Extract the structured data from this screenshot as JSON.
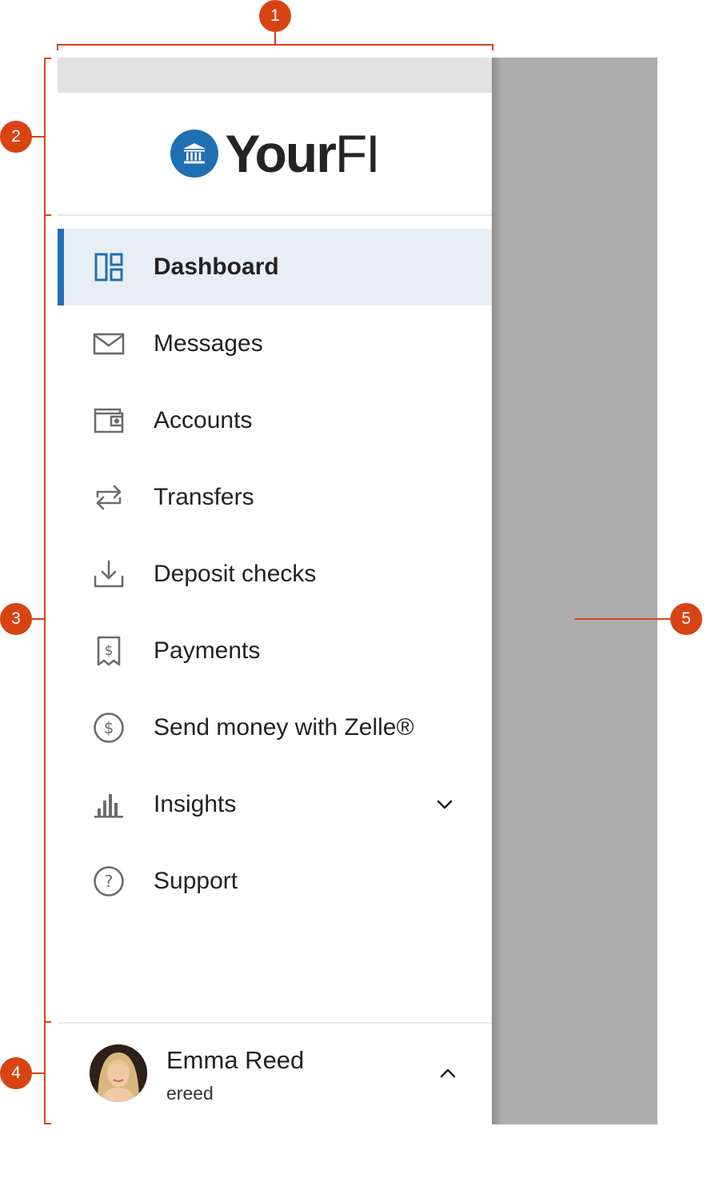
{
  "brand": {
    "name_bold": "Your",
    "name_light": "FI",
    "logo": "bank-icon",
    "accent": "#1f6fb3"
  },
  "nav": {
    "items": [
      {
        "label": "Dashboard",
        "icon": "dashboard-icon",
        "active": true
      },
      {
        "label": "Messages",
        "icon": "envelope-icon"
      },
      {
        "label": "Accounts",
        "icon": "wallet-icon"
      },
      {
        "label": "Transfers",
        "icon": "transfer-arrows-icon"
      },
      {
        "label": "Deposit checks",
        "icon": "download-tray-icon"
      },
      {
        "label": "Payments",
        "icon": "receipt-dollar-icon"
      },
      {
        "label": "Send money with Zelle®",
        "icon": "dollar-circle-icon"
      },
      {
        "label": "Insights",
        "icon": "bar-chart-icon",
        "expandable": true
      },
      {
        "label": "Support",
        "icon": "question-circle-icon"
      }
    ]
  },
  "user": {
    "name": "Emma Reed",
    "handle": "ereed"
  },
  "callouts": [
    "1",
    "2",
    "3",
    "4",
    "5"
  ],
  "colors": {
    "annotation": "#d84314",
    "scrim": "#adadad",
    "active_bg": "#e8eef5"
  }
}
